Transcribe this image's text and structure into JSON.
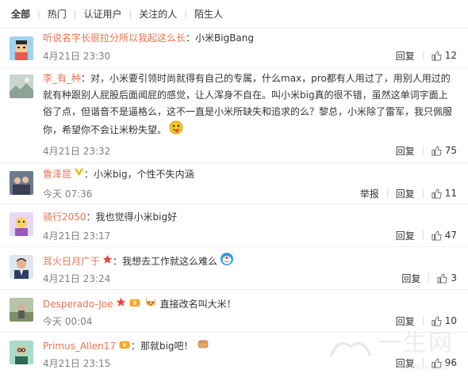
{
  "filters": [
    "全部",
    "热门",
    "认证用户",
    "关注的人",
    "陌生人"
  ],
  "colors": {
    "author": "#eb7350",
    "meta": "#808080",
    "text": "#333333"
  },
  "comments": [
    {
      "author": "听说名字长很拉分所以我起这么长",
      "content": "：小米BigBang",
      "time": "4月21日 23:30",
      "reply": "回复",
      "likes": "12",
      "avatar_icon": "pixel-boy-avatar-icon"
    },
    {
      "author": "李_有_种",
      "content": "：对，小米要引领时尚就得有自己的专属，什么max，pro都有人用过了，用别人用过的就有种跟别人屁股后面闻屁的感觉，让人浑身不自在。叫小米big真的很不错，虽然这单词字面上俗了点，但谐音不是逼格么，这不一直是小米所缺失和追求的么？黎总，小米除了雷军，我只佩服你，希望你不会让米粉失望。",
      "time": "4月21日 23:32",
      "reply": "回复",
      "likes": "75",
      "avatar_icon": "landscape-avatar-icon",
      "emoji": "tongue-face-emoji-icon"
    },
    {
      "author": "鲁泽昆",
      "content": "：小米big，个性不失内涵",
      "time": "今天 07:36",
      "report": "举报",
      "reply": "回复",
      "likes": "11",
      "avatar_icon": "group-photo-avatar-icon",
      "badge": "verified-v-icon"
    },
    {
      "author": "骑行2050",
      "content": "：我也觉得小米big好",
      "time": "4月21日 23:17",
      "reply": "回复",
      "likes": "47",
      "avatar_icon": "cartoon-avatar-icon"
    },
    {
      "author": "耳火日月广于",
      "content": "：我想去工作就这么难么",
      "time": "4月21日 23:24",
      "reply": "回复",
      "likes": "3",
      "avatar_icon": "portrait-avatar-icon",
      "badge": "star-badge-icon",
      "emoji": "doraemon-emoji-icon"
    },
    {
      "author": "Desperado-Joe",
      "content": "直接改名叫大米！",
      "time": "今天 00:04",
      "reply": "回复",
      "likes": "10",
      "avatar_icon": "outdoor-avatar-icon",
      "badge": "star-badge-icon",
      "emoji": "cat-emoji-icon"
    },
    {
      "author": "Primus_Allen17",
      "content": "：那就big吧！",
      "time": "4月21日 23:15",
      "reply": "回复",
      "likes": "96",
      "avatar_icon": "glasses-avatar-icon",
      "emoji": "fist-emoji-icon"
    }
  ],
  "watermark": {
    "text": "一生网",
    "sub": "1SND.COM"
  }
}
